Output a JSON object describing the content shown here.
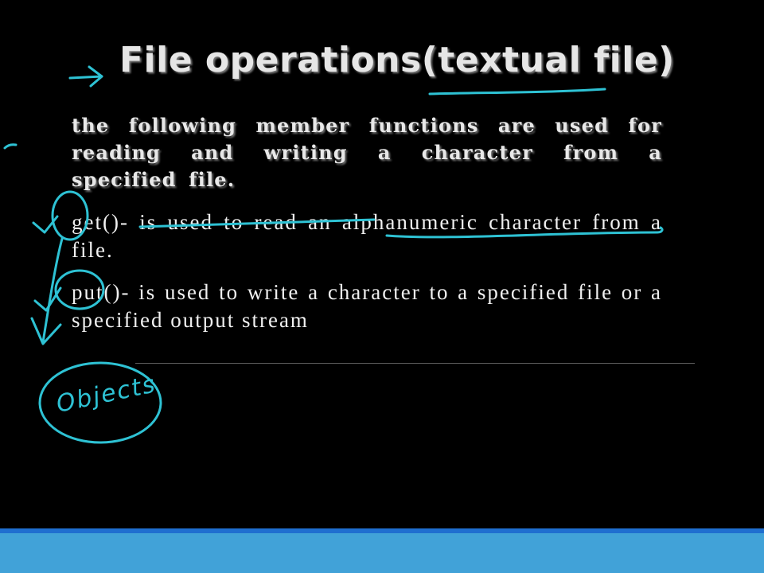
{
  "slide": {
    "title": "File operations(textual file)",
    "intro": "the following member functions are used for reading and writing a character from a specified file.",
    "get_text": "get()- is used to read an alphanumeric character from a file.",
    "put_text": "put()- is used to write a character to a specified file or a specified output stream"
  },
  "annotations": {
    "handwritten_note": "Objects",
    "ink_color": "#2ec2d4"
  },
  "colors": {
    "background": "#000000",
    "footer": "#41a2d8",
    "footer_line": "#1f6fd0"
  }
}
